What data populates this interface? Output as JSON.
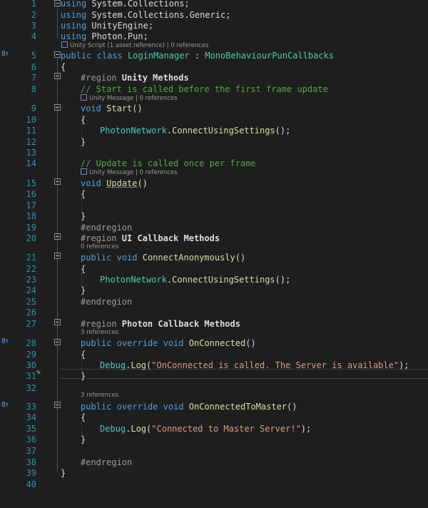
{
  "code_lens": {
    "unity_script": "Unity Script (1 asset reference) | 0 references",
    "unity_message_start": "Unity Message | 0 references",
    "unity_message_update": "Unity Message | 0 references",
    "refs_connect_anon": "0 references",
    "refs_on_connected": "3 references",
    "refs_on_connected_master": "3 references"
  },
  "lines": [
    {
      "n": "1",
      "tokens": [
        {
          "t": "using",
          "c": "kw"
        },
        {
          "t": " System.Collections;"
        }
      ]
    },
    {
      "n": "2",
      "tokens": [
        {
          "t": "using",
          "c": "kw"
        },
        {
          "t": " System.Collections.Generic;"
        }
      ]
    },
    {
      "n": "3",
      "tokens": [
        {
          "t": "using",
          "c": "kw"
        },
        {
          "t": " UnityEngine;"
        }
      ]
    },
    {
      "n": "4",
      "tokens": [
        {
          "t": "using",
          "c": "kw"
        },
        {
          "t": " Photon.Pun;"
        }
      ]
    },
    {
      "n": "5",
      "tokens": [
        {
          "t": "public",
          "c": "kw"
        },
        {
          "t": " "
        },
        {
          "t": "class",
          "c": "kw"
        },
        {
          "t": " "
        },
        {
          "t": "LoginManager",
          "c": "ty"
        },
        {
          "t": " : "
        },
        {
          "t": "MonoBehaviourPunCallbacks",
          "c": "ty"
        }
      ]
    },
    {
      "n": "6",
      "tokens": [
        {
          "t": "{"
        }
      ]
    },
    {
      "n": "7",
      "tokens": [
        {
          "t": "#region",
          "c": "pp"
        },
        {
          "t": " Unity Methods",
          "c": "bold"
        }
      ]
    },
    {
      "n": "8",
      "tokens": [
        {
          "t": "// Start is called before the first frame update",
          "c": "cm"
        }
      ]
    },
    {
      "n": "9",
      "tokens": [
        {
          "t": "void",
          "c": "kw"
        },
        {
          "t": " "
        },
        {
          "t": "Start",
          "c": "fn"
        },
        {
          "t": "()"
        }
      ]
    },
    {
      "n": "10",
      "tokens": [
        {
          "t": "{"
        }
      ]
    },
    {
      "n": "11",
      "tokens": [
        {
          "t": "PhotonNetwork",
          "c": "ty"
        },
        {
          "t": "."
        },
        {
          "t": "ConnectUsingSettings",
          "c": "fn"
        },
        {
          "t": "();"
        }
      ]
    },
    {
      "n": "12",
      "tokens": [
        {
          "t": "}"
        }
      ]
    },
    {
      "n": "13",
      "tokens": []
    },
    {
      "n": "14",
      "tokens": [
        {
          "t": "// Update is called once per frame",
          "c": "cm"
        }
      ]
    },
    {
      "n": "15",
      "tokens": [
        {
          "t": "void",
          "c": "kw"
        },
        {
          "t": " "
        },
        {
          "t": "Update",
          "c": "fn ul"
        },
        {
          "t": "()"
        }
      ]
    },
    {
      "n": "16",
      "tokens": [
        {
          "t": "{"
        }
      ]
    },
    {
      "n": "17",
      "tokens": []
    },
    {
      "n": "18",
      "tokens": [
        {
          "t": "}"
        }
      ]
    },
    {
      "n": "19",
      "tokens": [
        {
          "t": "#endregion",
          "c": "pp"
        }
      ]
    },
    {
      "n": "20",
      "tokens": [
        {
          "t": "#region",
          "c": "pp"
        },
        {
          "t": " UI Callback Methods",
          "c": "bold"
        }
      ]
    },
    {
      "n": "21",
      "tokens": [
        {
          "t": "public",
          "c": "kw"
        },
        {
          "t": " "
        },
        {
          "t": "void",
          "c": "kw"
        },
        {
          "t": " "
        },
        {
          "t": "ConnectAnonymously",
          "c": "fn"
        },
        {
          "t": "()"
        }
      ]
    },
    {
      "n": "22",
      "tokens": [
        {
          "t": "{"
        }
      ]
    },
    {
      "n": "23",
      "tokens": [
        {
          "t": "PhotonNetwork",
          "c": "ty"
        },
        {
          "t": "."
        },
        {
          "t": "ConnectUsingSettings",
          "c": "fn"
        },
        {
          "t": "();"
        }
      ]
    },
    {
      "n": "24",
      "tokens": [
        {
          "t": "}"
        }
      ]
    },
    {
      "n": "25",
      "tokens": [
        {
          "t": "#endregion",
          "c": "pp"
        }
      ]
    },
    {
      "n": "26",
      "tokens": []
    },
    {
      "n": "27",
      "tokens": [
        {
          "t": "#region",
          "c": "pp"
        },
        {
          "t": " Photon Callback Methods",
          "c": "bold"
        }
      ]
    },
    {
      "n": "28",
      "tokens": [
        {
          "t": "public",
          "c": "kw"
        },
        {
          "t": " "
        },
        {
          "t": "override",
          "c": "kw"
        },
        {
          "t": " "
        },
        {
          "t": "void",
          "c": "kw"
        },
        {
          "t": " "
        },
        {
          "t": "OnConnected",
          "c": "fn"
        },
        {
          "t": "()"
        }
      ]
    },
    {
      "n": "29",
      "tokens": [
        {
          "t": "{"
        }
      ]
    },
    {
      "n": "30",
      "tokens": [
        {
          "t": "Debug",
          "c": "ty"
        },
        {
          "t": "."
        },
        {
          "t": "Log",
          "c": "fn"
        },
        {
          "t": "("
        },
        {
          "t": "\"OnConnected is called. The Server is available\"",
          "c": "st"
        },
        {
          "t": ");"
        }
      ]
    },
    {
      "n": "31",
      "tokens": [
        {
          "t": "}"
        }
      ]
    },
    {
      "n": "32",
      "tokens": []
    },
    {
      "n": "33",
      "tokens": [
        {
          "t": "public",
          "c": "kw"
        },
        {
          "t": " "
        },
        {
          "t": "override",
          "c": "kw"
        },
        {
          "t": " "
        },
        {
          "t": "void",
          "c": "kw"
        },
        {
          "t": " "
        },
        {
          "t": "OnConnectedToMaster",
          "c": "fn"
        },
        {
          "t": "()"
        }
      ]
    },
    {
      "n": "34",
      "tokens": [
        {
          "t": "{"
        }
      ]
    },
    {
      "n": "35",
      "tokens": [
        {
          "t": "Debug",
          "c": "ty"
        },
        {
          "t": "."
        },
        {
          "t": "Log",
          "c": "fn"
        },
        {
          "t": "("
        },
        {
          "t": "\"Connected to Master Server!\"",
          "c": "st"
        },
        {
          "t": ");"
        }
      ]
    },
    {
      "n": "36",
      "tokens": [
        {
          "t": "}"
        }
      ]
    },
    {
      "n": "37",
      "tokens": []
    },
    {
      "n": "38",
      "tokens": [
        {
          "t": "#endregion",
          "c": "pp"
        }
      ]
    },
    {
      "n": "39",
      "tokens": [
        {
          "t": "}"
        }
      ]
    },
    {
      "n": "40",
      "tokens": []
    }
  ]
}
